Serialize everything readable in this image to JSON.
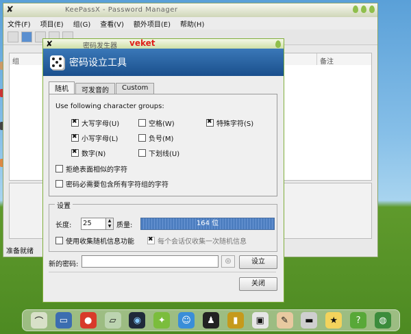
{
  "main_window": {
    "title": "KeePassX - Password Manager",
    "menu": [
      "文件(F)",
      "项目(E)",
      "组(G)",
      "查看(V)",
      "额外项目(E)",
      "帮助(H)"
    ],
    "list_columns": [
      "组",
      "备注"
    ],
    "status": "准备就绪"
  },
  "dialog": {
    "title": "密码发生器",
    "overlay_label": "veket",
    "header_title": "密码设立工具",
    "tabs": [
      "随机",
      "可发音的",
      "Custom"
    ],
    "char_groups_label": "Use following character groups:",
    "options": {
      "upper": {
        "label": "大写字母(U)",
        "checked": true
      },
      "space": {
        "label": "空格(W)",
        "checked": false
      },
      "special": {
        "label": "特殊字符(S)",
        "checked": true
      },
      "lower": {
        "label": "小写字母(L)",
        "checked": true
      },
      "minus": {
        "label": "负号(M)",
        "checked": false
      },
      "digits": {
        "label": "数字(N)",
        "checked": true
      },
      "underline": {
        "label": "下划线(U)",
        "checked": false
      },
      "exclude_lookalike": {
        "label": "拒绝表面相似的字符",
        "checked": false
      },
      "every_group": {
        "label": "密码必需要包含所有字符组的字符",
        "checked": false
      }
    },
    "settings": {
      "title": "设置",
      "length_label": "长度:",
      "length_value": "25",
      "quality_label": "质量:",
      "quality_value": "164 位",
      "entropy_label": "使用收集随机信息功能",
      "entropy_once_label": "每个会话仅收集一次随机信息"
    },
    "new_password_label": "新的密码:",
    "new_password_value": "",
    "generate_button": "设立",
    "close_button": "关闭"
  }
}
